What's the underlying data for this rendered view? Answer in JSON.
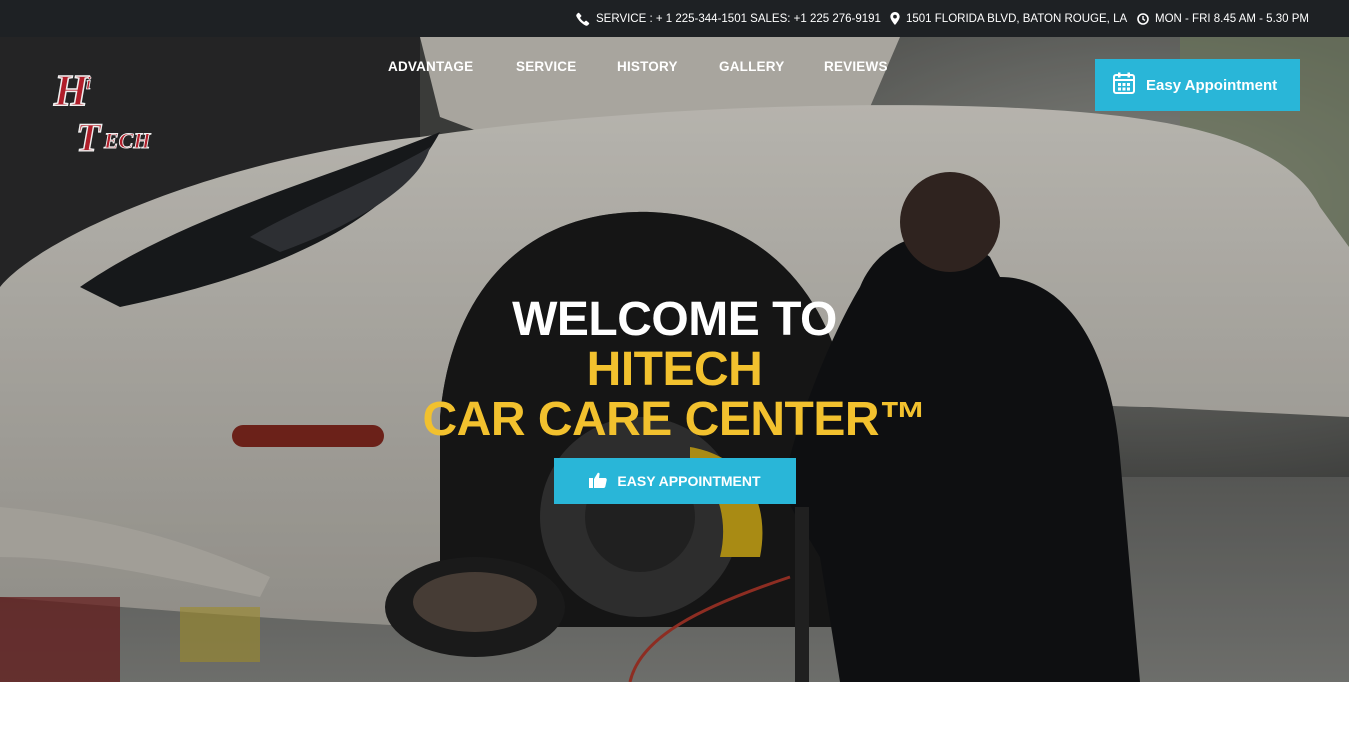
{
  "topbar": {
    "phone_icon": "phone-icon",
    "phones": "SERVICE : + 1 225-344-1501 SALES: +1 225 276-9191",
    "location_icon": "map-marker-icon",
    "address": "1501 FLORIDA BLVD, BATON ROUGE, LA",
    "clock_icon": "clock-icon",
    "hours": "MON - FRI 8.45 AM - 5.30 PM"
  },
  "logo": {
    "text_top": "Hi",
    "text_main": "Tech",
    "icon": "hitech-logo"
  },
  "nav": {
    "items": [
      {
        "label": "ADVANTAGE"
      },
      {
        "label": "SERVICE"
      },
      {
        "label": "HISTORY"
      },
      {
        "label": "GALLERY"
      },
      {
        "label": "REVIEWS"
      }
    ]
  },
  "header_button": {
    "label": "Easy Appointment",
    "icon": "calendar-icon"
  },
  "hero": {
    "line1": "WELCOME TO",
    "line2": "HITECH",
    "line3": "CAR CARE CENTER™",
    "cta_label": "EASY APPOINTMENT",
    "cta_icon": "thumbs-up-icon"
  },
  "colors": {
    "topbar_bg": "#1e2124",
    "accent": "#29b6d8",
    "headline_yellow": "#f2c12e",
    "logo_red": "#b01e2a"
  }
}
